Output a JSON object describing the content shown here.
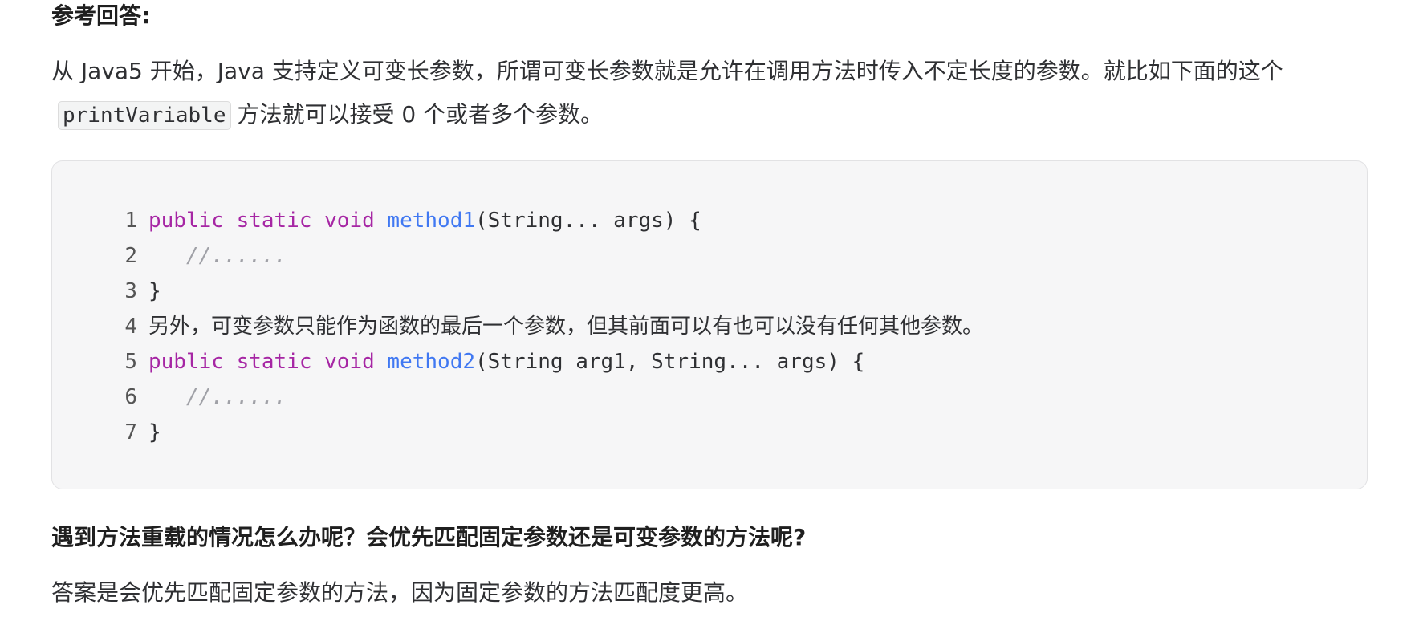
{
  "heading": "参考回答:",
  "intro": {
    "before_code": "从 Java5 开始，Java 支持定义可变长参数，所谓可变长参数就是允许在调用方法时传入不定长度的参数。就比如下面的这个",
    "code": "printVariable",
    "after_code": "方法就可以接受 0 个或者多个参数。"
  },
  "code_block": {
    "lines": [
      {
        "num": "1",
        "tokens": [
          {
            "type": "kw",
            "text": "public static void "
          },
          {
            "type": "fn",
            "text": "method1"
          },
          {
            "type": "plain",
            "text": "(String... args) {"
          }
        ]
      },
      {
        "num": "2",
        "tokens": [
          {
            "type": "cm",
            "text": "   //......"
          }
        ]
      },
      {
        "num": "3",
        "tokens": [
          {
            "type": "plain",
            "text": "}"
          }
        ]
      },
      {
        "num": "4",
        "tokens": [
          {
            "type": "prose",
            "text": "另外，可变参数只能作为函数的最后一个参数，但其前面可以有也可以没有任何其他参数。"
          }
        ]
      },
      {
        "num": "5",
        "tokens": [
          {
            "type": "kw",
            "text": "public static void "
          },
          {
            "type": "fn",
            "text": "method2"
          },
          {
            "type": "plain",
            "text": "(String arg1, String... args) {"
          }
        ]
      },
      {
        "num": "6",
        "tokens": [
          {
            "type": "cm",
            "text": "   //......"
          }
        ]
      },
      {
        "num": "7",
        "tokens": [
          {
            "type": "plain",
            "text": "}"
          }
        ]
      }
    ]
  },
  "subheading": "遇到方法重载的情况怎么办呢？会优先匹配固定参数还是可变参数的方法呢?",
  "answer": "答案是会优先匹配固定参数的方法，因为固定参数的方法匹配度更高。",
  "colors": {
    "keyword": "#a626a4",
    "function": "#4078f2",
    "comment": "#a0a1a7",
    "code_background": "#f6f6f7"
  }
}
